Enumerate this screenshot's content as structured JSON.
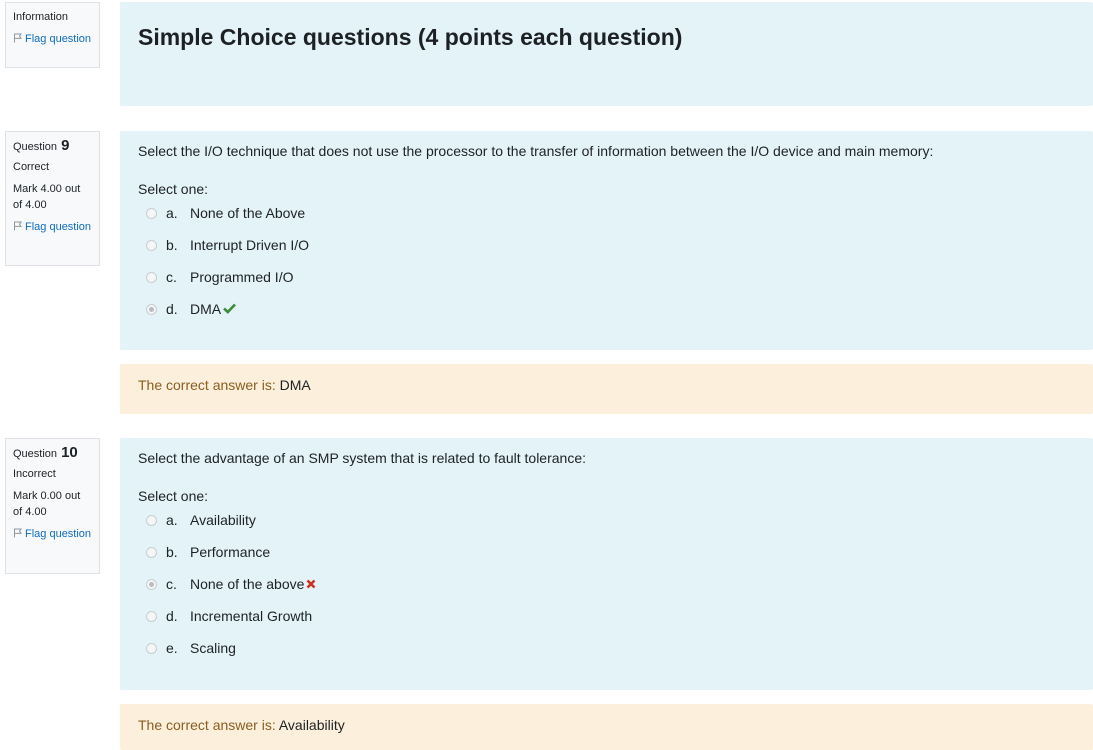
{
  "info": {
    "label": "Information",
    "flag_label": "Flag question"
  },
  "section": {
    "heading": "Simple Choice questions (4 points each question)"
  },
  "questions": [
    {
      "q_label": "Question",
      "number": "9",
      "state": "Correct",
      "grade": "Mark 4.00 out of 4.00",
      "flag_label": "Flag question",
      "text": "Select the I/O technique that does not use the processor to the transfer of information between the I/O device and main memory:",
      "prompt": "Select one:",
      "answers": [
        {
          "letter": "a.",
          "text": "None of the Above",
          "selected": false
        },
        {
          "letter": "b.",
          "text": "Interrupt Driven I/O",
          "selected": false
        },
        {
          "letter": "c.",
          "text": "Programmed I/O",
          "selected": false
        },
        {
          "letter": "d.",
          "text": "DMA",
          "selected": true,
          "mark": "correct"
        }
      ],
      "feedback_label": "The correct answer is:",
      "correct_answer": "DMA"
    },
    {
      "q_label": "Question",
      "number": "10",
      "state": "Incorrect",
      "grade": "Mark 0.00 out of 4.00",
      "flag_label": "Flag question",
      "text": "Select the advantage of an SMP system that is related to fault tolerance:",
      "prompt": "Select one:",
      "answers": [
        {
          "letter": "a.",
          "text": "Availability",
          "selected": false
        },
        {
          "letter": "b.",
          "text": "Performance",
          "selected": false
        },
        {
          "letter": "c.",
          "text": "None of the above",
          "selected": true,
          "mark": "incorrect"
        },
        {
          "letter": "d.",
          "text": "Incremental Growth",
          "selected": false
        },
        {
          "letter": "e.",
          "text": "Scaling",
          "selected": false
        }
      ],
      "feedback_label": "The correct answer is:",
      "correct_answer": "Availability"
    }
  ],
  "icons": {
    "flag": "flag-icon",
    "correct": "check-icon",
    "incorrect": "cross-icon"
  },
  "colors": {
    "formulation_bg": "#e3f3f7",
    "feedback_bg": "#fcefdc",
    "link": "#0f6cbf",
    "correct": "#3d8b37",
    "incorrect": "#ca3120"
  }
}
